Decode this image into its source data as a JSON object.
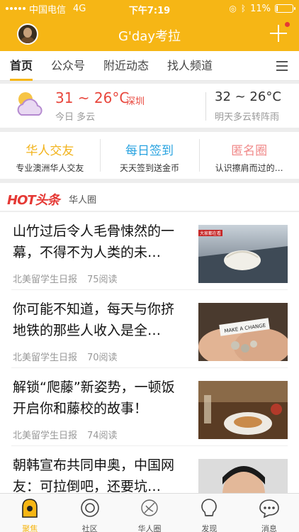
{
  "status_bar": {
    "carrier": "中国电信",
    "network": "4G",
    "time": "下午7:19",
    "battery": "11%",
    "battery_level": 0.11
  },
  "header": {
    "title": "G'day考拉"
  },
  "tabs": [
    {
      "label": "首页"
    },
    {
      "label": "公众号"
    },
    {
      "label": "附近动态"
    },
    {
      "label": "找人频道"
    }
  ],
  "weather": {
    "today_temp": "31 ~ 26°C",
    "city": "深圳",
    "today_desc": "今日 多云",
    "tomorrow_temp": "32 ~ 26°C",
    "tomorrow_desc": "明天多云转阵雨"
  },
  "features": [
    {
      "title": "华人交友",
      "subtitle": "专业澳洲华人交友",
      "color": "#f2b31b"
    },
    {
      "title": "每日签到",
      "subtitle": "天天签到送金币",
      "color": "#29a3e0"
    },
    {
      "title": "匿名圈",
      "subtitle": "认识擦肩而过的…",
      "color": "#f08a8a"
    }
  ],
  "hot": {
    "logo": "HOT头条",
    "subtitle": "华人圈"
  },
  "articles": [
    {
      "title": "山竹过后令人毛骨悚然的一幕，不得不为人类的未…",
      "source": "北美留学生日报",
      "reads": "75阅读",
      "image_label": "大家都在看"
    },
    {
      "title": "你可能不知道，每天与你挤地铁的那些人收入是全…",
      "source": "北美留学生日报",
      "reads": "70阅读",
      "image_label": "MAKE A CHANGE"
    },
    {
      "title": "解锁“爬藤”新姿势，一顿饭开启你和藤校的故事！",
      "source": "北美留学生日报",
      "reads": "74阅读"
    },
    {
      "title": "朝韩宣布共同申奥，中国网友：可拉倒吧，还要坑…",
      "source": "",
      "reads": ""
    }
  ],
  "bottom_nav": [
    {
      "label": "聚焦",
      "icon": "focus-icon",
      "active": true
    },
    {
      "label": "社区",
      "icon": "community-icon",
      "active": false
    },
    {
      "label": "华人圈",
      "icon": "chinese-circle-icon",
      "active": false
    },
    {
      "label": "发现",
      "icon": "discover-icon",
      "active": false
    },
    {
      "label": "消息",
      "icon": "message-icon",
      "active": false
    }
  ],
  "colors": {
    "brand": "#f6b615",
    "temp_red": "#e8463c",
    "hot_red": "#e53935"
  }
}
